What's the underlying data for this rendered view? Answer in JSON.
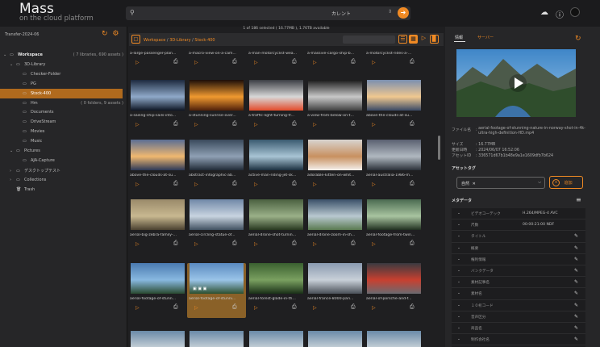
{
  "app": {
    "name": "Mass",
    "subtitle": "on the cloud platform"
  },
  "search": {
    "value": "カレント",
    "select_arrow": "⇕",
    "go_icon": "arrow-right-icon"
  },
  "header_icons": [
    "cloud-upload-icon",
    "help-icon",
    "user-avatar-icon"
  ],
  "sidebar": {
    "title": "Transfer-2024-06",
    "tree": [
      {
        "label": "Workspace",
        "count": "( 7 libraries, 690 assets )",
        "expanded": true,
        "bold": true
      },
      {
        "label": "3D-Library",
        "count": "",
        "expanded": true
      },
      {
        "label": "Checker-Folder",
        "count": ""
      },
      {
        "label": "PG",
        "count": ""
      },
      {
        "label": "Stock-400",
        "count": "",
        "selected": true
      },
      {
        "label": "Hm",
        "count": "( 0 folders, 9 assets )"
      },
      {
        "label": "Documents",
        "count": ""
      },
      {
        "label": "DriveStream",
        "count": ""
      },
      {
        "label": "Movies",
        "count": ""
      },
      {
        "label": "Music",
        "count": ""
      },
      {
        "label": "Pictures",
        "count": "",
        "expanded": true
      },
      {
        "label": "AJA-Capture",
        "count": ""
      },
      {
        "label": "デスクトップテスト",
        "count": "",
        "collapsed": true
      },
      {
        "label": "Collections",
        "count": "",
        "collapsed": true
      },
      {
        "label": "Trash",
        "count": ""
      }
    ]
  },
  "main": {
    "status": "1 of 186 selected ( 16.77MB ), 1.76TB available",
    "breadcrumb": [
      "Workspace",
      "3D-Library",
      "Stock-400"
    ],
    "assets": [
      {
        "title": "a-large-passenger-plan..."
      },
      {
        "title": "a-macro-view-on-a-cam..."
      },
      {
        "title": "a-man-motorcyclist-wea..."
      },
      {
        "title": "a-massive-cargo-ship-b..."
      },
      {
        "title": "a-motorcyclist-rides-a-..."
      },
      {
        "title": "a-sailing-ship-sails-into..."
      },
      {
        "title": "a-stunning-sunrise-over..."
      },
      {
        "title": "a-traffic-light-turning-fr..."
      },
      {
        "title": "a-view-from-below-on-t..."
      },
      {
        "title": "above-the-clouds-at-su..."
      },
      {
        "title": "above-the-clouds-at-su..."
      },
      {
        "title": "abstract-infographic-ab..."
      },
      {
        "title": "active-man-riding-jet-sk..."
      },
      {
        "title": "adorable-kitten-on-whit..."
      },
      {
        "title": "aerial-australia-1986-m..."
      },
      {
        "title": "aerial-big-zebra-family-..."
      },
      {
        "title": "aerial-circling-statue-of..."
      },
      {
        "title": "aerial-drone-shot-turnin..."
      },
      {
        "title": "aerial-drone-zoom-in-sh..."
      },
      {
        "title": "aerial-footage-from-twin..."
      },
      {
        "title": "aerial-footage-of-stunn..."
      },
      {
        "title": "aerial-footage-of-stunni..."
      },
      {
        "title": "aerial-forest-glade-in-th..."
      },
      {
        "title": "aerial-france-8000-pari..."
      },
      {
        "title": "aerial-of-porsche-and-f..."
      }
    ]
  },
  "details": {
    "tabs": [
      "情報",
      "サーバー"
    ],
    "file_label": "ファイル名",
    "file_value": "aerial-footage-of-stunning-nature-in-norway-shot-in-4k-ultra-high-definition-HD.mp4",
    "size_label": "サイズ",
    "size_value": "16.77MB",
    "date_label": "更新日時",
    "date_value": "2024/06/07 16:52:06",
    "asset_id_label": "アセットID",
    "asset_id_value": "336571d67b1b48e9a1e1609dfb7b624",
    "tags_heading": "アセットタグ",
    "tag": "自然",
    "add_label": "追加",
    "metadata_heading": "メタデータ",
    "metadata": [
      {
        "label": "ビデオコーデック",
        "value": "H.264/MPEG-4 AVC",
        "editable": false
      },
      {
        "label": "尺数",
        "value": "00:00:21:00 NDF",
        "editable": false
      },
      {
        "label": "タイトル",
        "value": "",
        "editable": true
      },
      {
        "label": "概要",
        "value": "",
        "editable": true
      },
      {
        "label": "権利情報",
        "value": "",
        "editable": true
      },
      {
        "label": "バンクデータ",
        "value": "",
        "editable": true
      },
      {
        "label": "素材記事名",
        "value": "",
        "editable": true
      },
      {
        "label": "素材名",
        "value": "",
        "editable": true
      },
      {
        "label": "１０桁コード",
        "value": "",
        "editable": true
      },
      {
        "label": "音声区分",
        "value": "",
        "editable": true
      },
      {
        "label": "商品名",
        "value": "",
        "editable": true
      },
      {
        "label": "制作会社名",
        "value": "",
        "editable": true
      }
    ]
  },
  "colors": {
    "accent": "#f08a24",
    "selected": "#b06a1d",
    "bg": "#1b1b1d"
  }
}
